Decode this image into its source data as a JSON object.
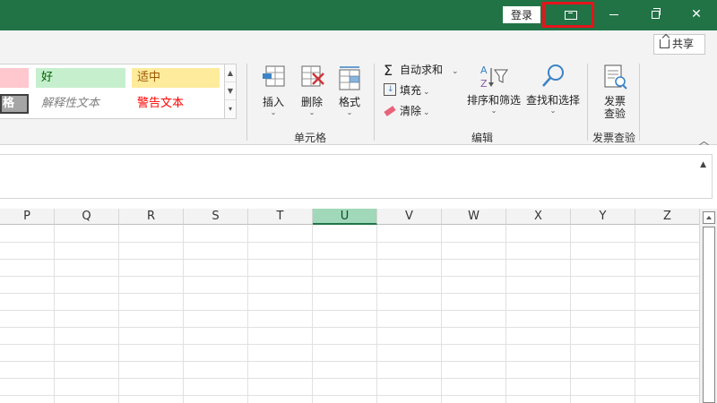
{
  "titlebar": {
    "login_label": "登录",
    "ribbon_mode_icon": "ribbon-display-options-icon",
    "highlight_color": "#e5141c",
    "brand_color": "#217346"
  },
  "ribbon": {
    "share_label": "共享",
    "styles": {
      "bad": "",
      "good": "好",
      "neutral": "适中",
      "check_cell": "格",
      "explanatory": "解释性文本",
      "warning": "警告文本"
    },
    "cells_group": {
      "label": "单元格",
      "insert": "插入",
      "delete": "删除",
      "format": "格式"
    },
    "editing_group": {
      "label": "编辑",
      "autosum": "自动求和",
      "fill": "填充",
      "clear": "清除",
      "sort_filter": "排序和筛选",
      "find_select": "查找和选择"
    },
    "invoice_group": {
      "label": "发票查验",
      "button_line1": "发票",
      "button_line2": "查验"
    }
  },
  "grid": {
    "columns": [
      "P",
      "Q",
      "R",
      "S",
      "T",
      "U",
      "V",
      "W",
      "X",
      "Y",
      "Z"
    ],
    "selected_column": "U"
  }
}
